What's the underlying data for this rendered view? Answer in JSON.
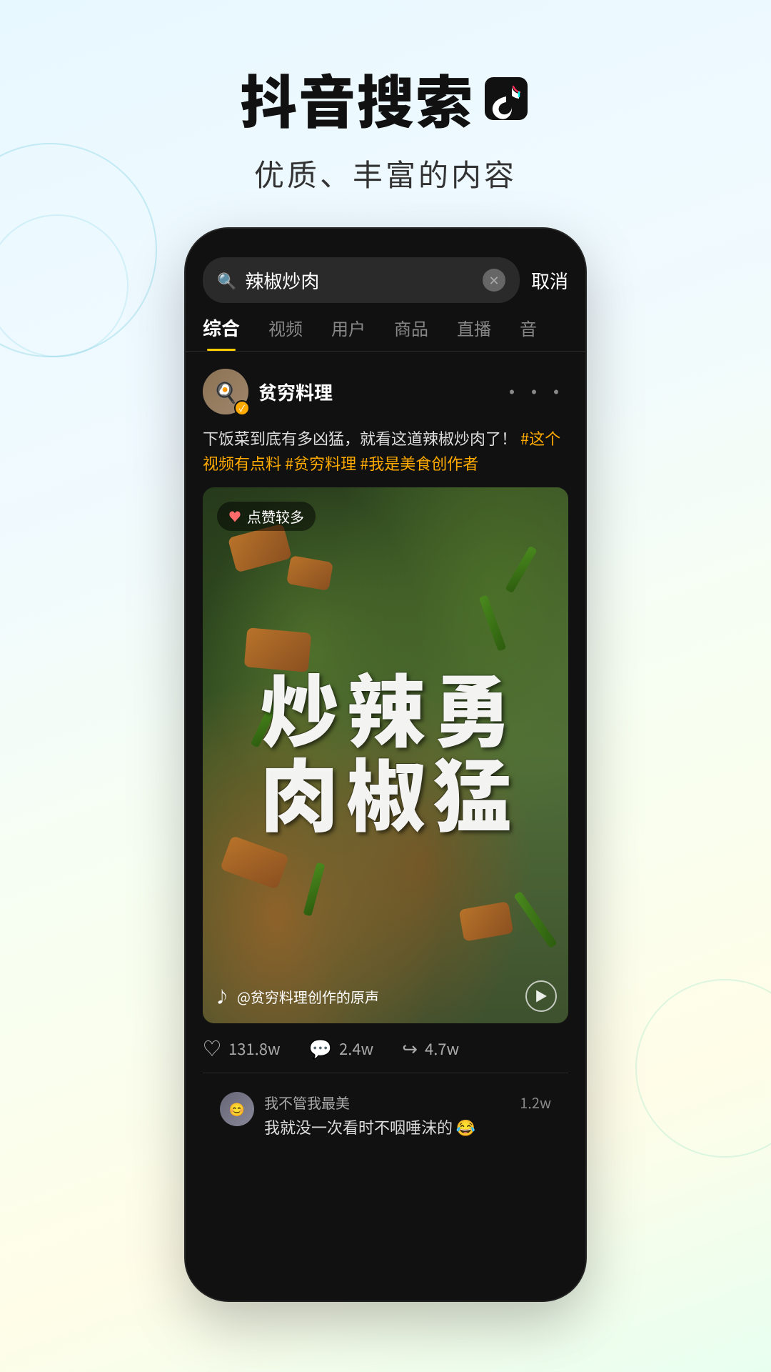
{
  "page": {
    "background": "gradient",
    "title": "抖音搜索",
    "logo_symbol": "♪",
    "subtitle": "优质、丰富的内容"
  },
  "phone": {
    "search": {
      "placeholder": "辣椒炒肉",
      "cancel_label": "取消"
    },
    "tabs": [
      {
        "label": "综合",
        "active": true
      },
      {
        "label": "视频",
        "active": false
      },
      {
        "label": "用户",
        "active": false
      },
      {
        "label": "商品",
        "active": false
      },
      {
        "label": "直播",
        "active": false
      },
      {
        "label": "音",
        "active": false
      }
    ],
    "post": {
      "author": "贫穷料理",
      "verified": true,
      "description": "下饭菜到底有多凶猛，就看这道辣椒炒肉了！",
      "hashtags": [
        "#这个视频有点料",
        "#贫穷料理",
        "#我是美食创作者"
      ],
      "hot_badge": "点赞较多",
      "video_title": "勇猛的辣椒炒肉",
      "video_calligraphy": "勇猛辣椒炒肉",
      "music_info": "@贫穷料理创作的原声",
      "stats": {
        "likes": "131.8w",
        "comments": "2.4w",
        "shares": "4.7w"
      },
      "comments": [
        {
          "name": "我不管我最美",
          "text": "我就没一次看时不咽唾沫的 😂",
          "count": "1.2w"
        }
      ]
    }
  }
}
